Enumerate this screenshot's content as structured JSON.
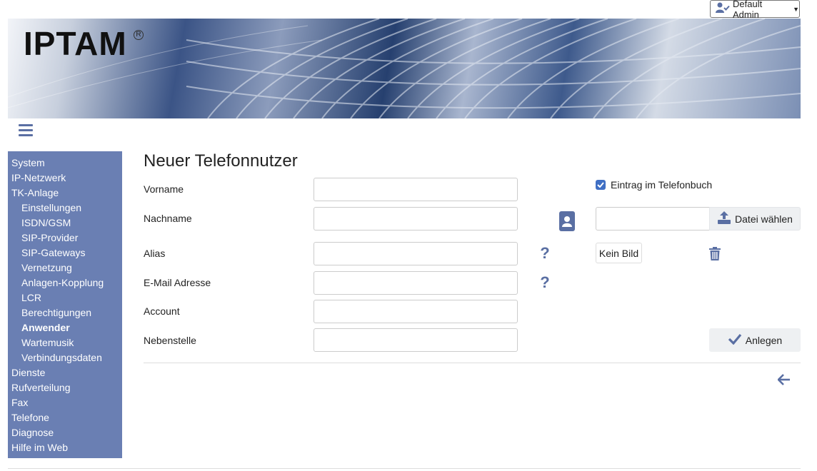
{
  "header": {
    "user_label": "Default Admin",
    "logo_text": "IPTAM",
    "logo_reg": "R"
  },
  "sidebar": {
    "items": [
      {
        "label": "System",
        "level": 0
      },
      {
        "label": "IP-Netzwerk",
        "level": 0
      },
      {
        "label": "TK-Anlage",
        "level": 0
      },
      {
        "label": "Einstellungen",
        "level": 1
      },
      {
        "label": "ISDN/GSM",
        "level": 1
      },
      {
        "label": "SIP-Provider",
        "level": 1
      },
      {
        "label": "SIP-Gateways",
        "level": 1
      },
      {
        "label": "Vernetzung",
        "level": 1
      },
      {
        "label": "Anlagen-Kopplung",
        "level": 1
      },
      {
        "label": "LCR",
        "level": 1
      },
      {
        "label": "Berechtigungen",
        "level": 1
      },
      {
        "label": "Anwender",
        "level": 1,
        "active": true
      },
      {
        "label": "Wartemusik",
        "level": 1
      },
      {
        "label": "Verbindungsdaten",
        "level": 1
      },
      {
        "label": "Dienste",
        "level": 0
      },
      {
        "label": "Rufverteilung",
        "level": 0
      },
      {
        "label": "Fax",
        "level": 0
      },
      {
        "label": "Telefone",
        "level": 0
      },
      {
        "label": "Diagnose",
        "level": 0
      },
      {
        "label": "Hilfe im Web",
        "level": 0
      }
    ]
  },
  "main": {
    "title": "Neuer Telefonnutzer",
    "fields": {
      "vorname": {
        "label": "Vorname",
        "value": ""
      },
      "nachname": {
        "label": "Nachname",
        "value": ""
      },
      "alias": {
        "label": "Alias",
        "value": ""
      },
      "email": {
        "label": "E-Mail Adresse",
        "value": ""
      },
      "account": {
        "label": "Account",
        "value": ""
      },
      "nebenstelle": {
        "label": "Nebenstelle",
        "value": ""
      }
    },
    "phonebook_checkbox": {
      "label": "Eintrag im Telefonbuch",
      "checked": true
    },
    "file_button": "Datei wählen",
    "no_image_button": "Kein Bild",
    "submit_button": "Anlegen"
  },
  "colors": {
    "sidebar_bg": "#6a7fb3",
    "accent": "#5a6fa3",
    "checkbox": "#3f6fc4"
  }
}
